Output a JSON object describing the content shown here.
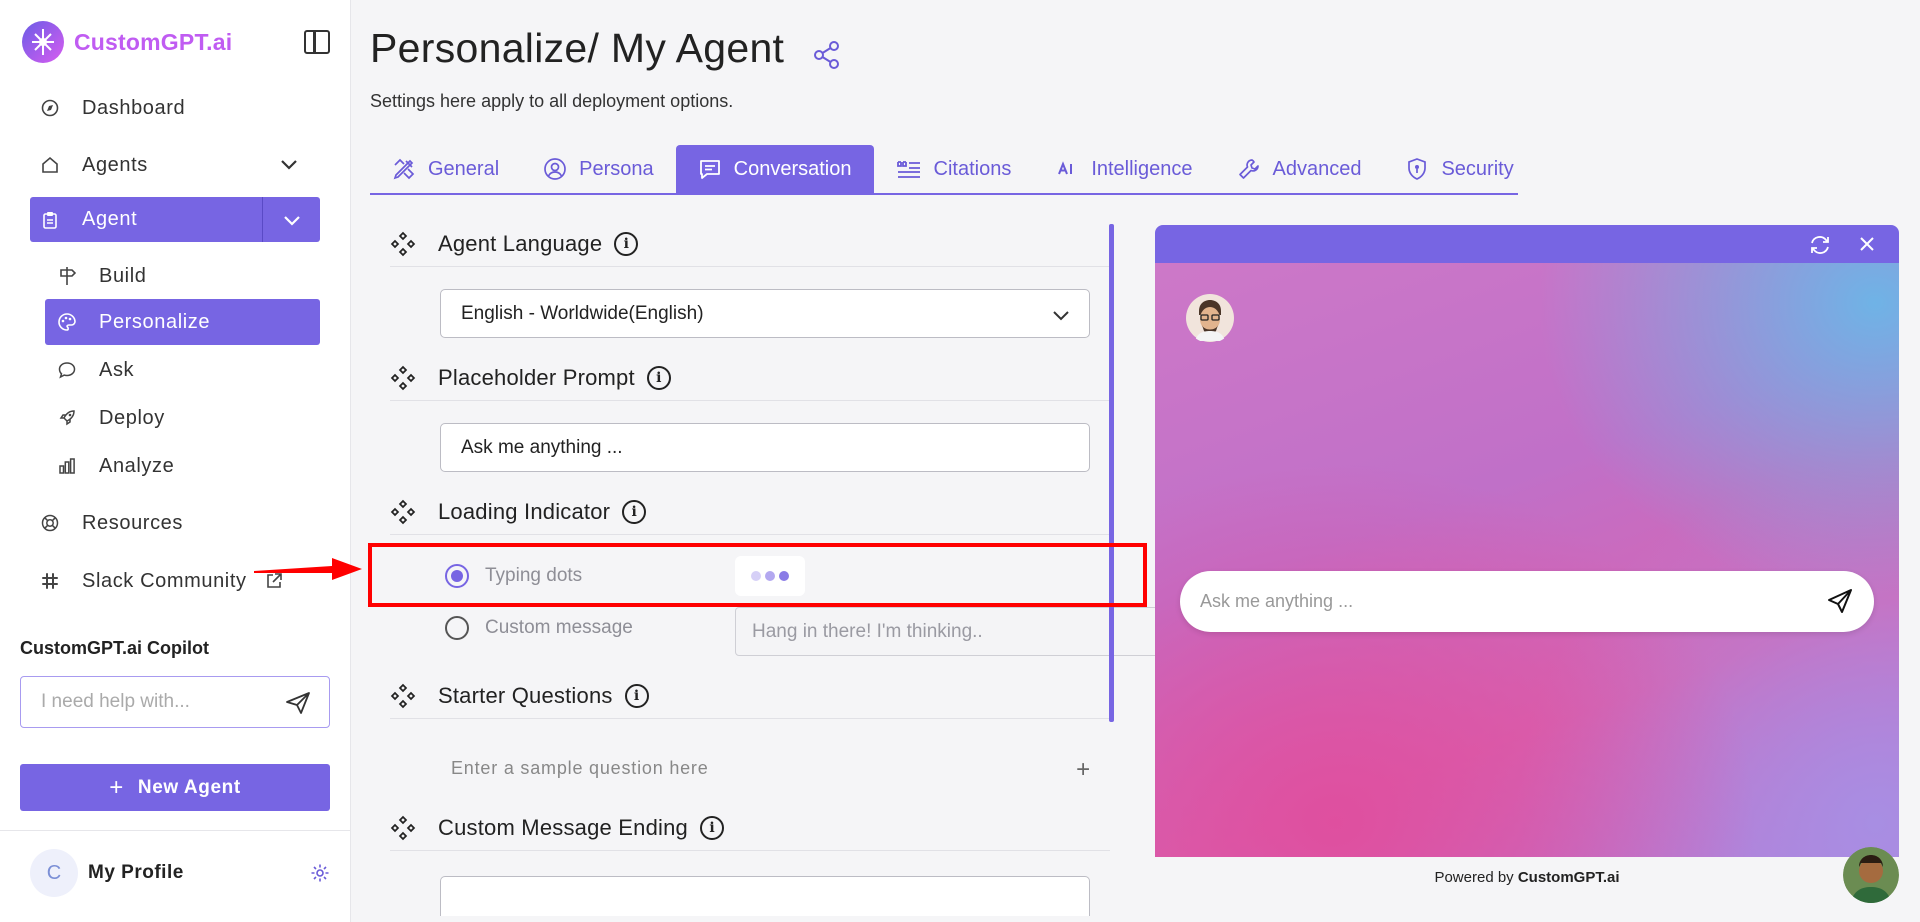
{
  "brand": {
    "name": "CustomGPT.ai"
  },
  "sidebar": {
    "items": [
      {
        "label": "Dashboard",
        "icon": "compass-icon"
      },
      {
        "label": "Agents",
        "icon": "home-icon"
      },
      {
        "label": "Agent",
        "icon": "clipboard-icon"
      },
      {
        "label": "Resources",
        "icon": "lifebuoy-icon"
      },
      {
        "label": "Slack Community",
        "icon": "slack-icon"
      }
    ],
    "sub_items": [
      {
        "label": "Build",
        "icon": "signpost-icon"
      },
      {
        "label": "Personalize",
        "icon": "palette-icon"
      },
      {
        "label": "Ask",
        "icon": "chat-icon"
      },
      {
        "label": "Deploy",
        "icon": "rocket-icon"
      },
      {
        "label": "Analyze",
        "icon": "bar-chart-icon"
      }
    ],
    "copilot": {
      "title": "CustomGPT.ai Copilot",
      "placeholder": "I need help with..."
    },
    "new_agent": "New Agent",
    "profile": {
      "initial": "C",
      "name": "My Profile"
    }
  },
  "page": {
    "title": "Personalize/ My Agent",
    "subtitle": "Settings here apply to all deployment options."
  },
  "tabs": [
    {
      "label": "General",
      "icon": "pencil-ruler-icon"
    },
    {
      "label": "Persona",
      "icon": "user-circle-icon"
    },
    {
      "label": "Conversation",
      "icon": "message-icon",
      "active": true
    },
    {
      "label": "Citations",
      "icon": "citations-icon"
    },
    {
      "label": "Intelligence",
      "icon": "ai-icon"
    },
    {
      "label": "Advanced",
      "icon": "wrench-icon"
    },
    {
      "label": "Security",
      "icon": "shield-icon"
    }
  ],
  "settings": {
    "agent_language": {
      "label": "Agent Language",
      "value": "English - Worldwide(English)"
    },
    "placeholder_prompt": {
      "label": "Placeholder Prompt",
      "value": "Ask me anything ..."
    },
    "loading_indicator": {
      "label": "Loading Indicator",
      "option_dots": "Typing dots",
      "option_custom": "Custom message",
      "custom_placeholder": "Hang in there! I'm thinking..",
      "selected": "Typing dots"
    },
    "starter_questions": {
      "label": "Starter Questions",
      "placeholder": "Enter a sample question here"
    },
    "custom_message_ending": {
      "label": "Custom Message Ending"
    }
  },
  "preview": {
    "input_placeholder": "Ask me anything ...",
    "powered_prefix": "Powered by",
    "powered_brand": "CustomGPT.ai"
  },
  "colors": {
    "accent": "#7765e3",
    "highlight": "#ff0000"
  }
}
